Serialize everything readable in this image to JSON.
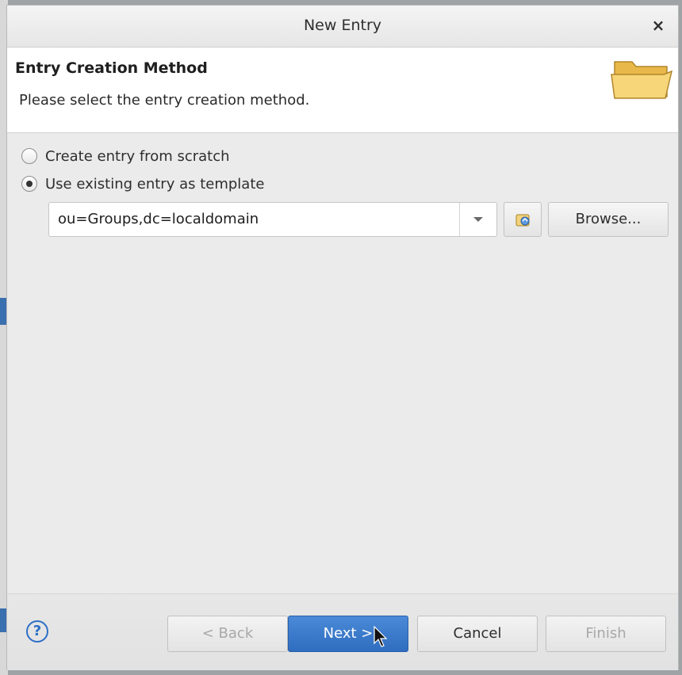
{
  "dialog": {
    "title": "New Entry",
    "close_glyph": "×"
  },
  "header": {
    "title": "Entry Creation Method",
    "description": "Please select the entry creation method.",
    "icon": "folder-icon"
  },
  "options": [
    {
      "label": "Create entry from scratch",
      "checked": false
    },
    {
      "label": "Use existing entry as template",
      "checked": true
    }
  ],
  "template": {
    "value": "ou=Groups,dc=localdomain",
    "browse_label": "Browse..."
  },
  "footer": {
    "help_glyph": "?",
    "back_label": "< Back",
    "next_label": "Next >",
    "cancel_label": "Cancel",
    "finish_label": "Finish"
  },
  "colors": {
    "primary": "#2f6dbf",
    "help": "#2d6fc7"
  }
}
